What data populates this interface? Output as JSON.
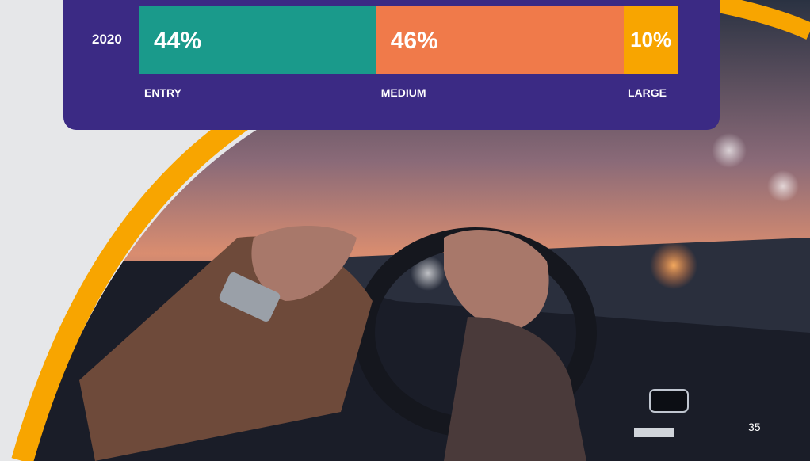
{
  "chart_data": {
    "type": "bar",
    "orientation": "horizontal",
    "stacked": true,
    "categories": [
      "2020"
    ],
    "series": [
      {
        "name": "ENTRY",
        "values": [
          44
        ],
        "label": "44%",
        "color": "#1a9a8b"
      },
      {
        "name": "MEDIUM",
        "values": [
          46
        ],
        "label": "46%",
        "color": "#f07a4a"
      },
      {
        "name": "LARGE",
        "values": [
          10
        ],
        "label": "10%",
        "color": "#f8a500"
      }
    ],
    "xlim": [
      0,
      100
    ],
    "grid": false,
    "legend_placement": "bottom"
  },
  "colors": {
    "card": "#3b2a84",
    "arc": "#f8a500",
    "background": "#e6e7e9"
  },
  "page_number": "35"
}
